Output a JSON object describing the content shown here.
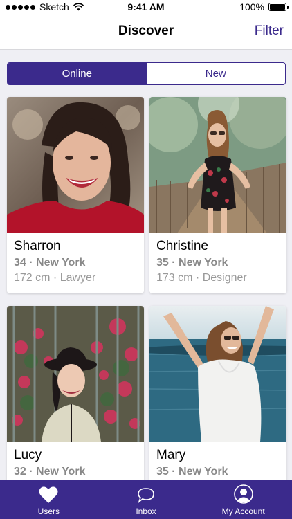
{
  "status_bar": {
    "carrier": "Sketch",
    "time": "9:41 AM",
    "battery": "100%"
  },
  "nav": {
    "title": "Discover",
    "filter_label": "Filter"
  },
  "segment": {
    "options": [
      "Online",
      "New"
    ],
    "selected": "Online"
  },
  "profiles": [
    {
      "name": "Sharron",
      "age_city": "34 · New York",
      "details": "172 cm · Lawyer"
    },
    {
      "name": "Christine",
      "age_city": "35 · New York",
      "details": "173 cm · Designer"
    },
    {
      "name": "Lucy",
      "age_city": "32 · New York",
      "details": ""
    },
    {
      "name": "Mary",
      "age_city": "35 · New York",
      "details": ""
    }
  ],
  "tabs": [
    {
      "label": "Users",
      "icon": "heart-icon"
    },
    {
      "label": "Inbox",
      "icon": "chat-bubble-icon"
    },
    {
      "label": "My Account",
      "icon": "user-avatar-icon"
    }
  ],
  "colors": {
    "accent": "#3b2a8c"
  }
}
